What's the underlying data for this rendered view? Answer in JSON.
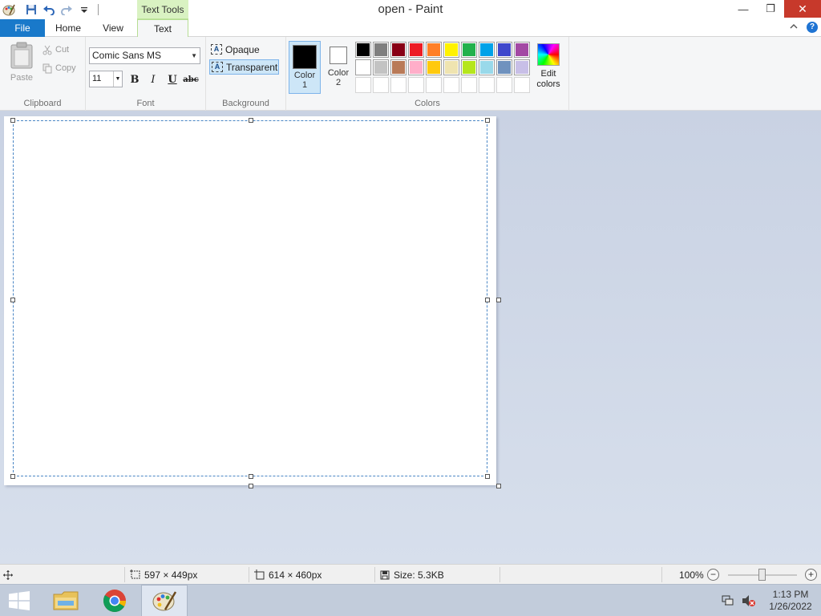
{
  "window": {
    "title": "open - Paint",
    "context_tab_group": "Text Tools",
    "minimize": "—",
    "restore": "❐",
    "close": "✕"
  },
  "tabs": {
    "file": "File",
    "home": "Home",
    "view": "View",
    "text": "Text"
  },
  "help": "?",
  "clipboard": {
    "label": "Clipboard",
    "paste": "Paste",
    "cut": "Cut",
    "copy": "Copy"
  },
  "font": {
    "label": "Font",
    "family": "Comic Sans MS",
    "size": "11",
    "bold": "B",
    "italic": "I",
    "underline": "U",
    "strike": "abc"
  },
  "background": {
    "label": "Background",
    "opaque": "Opaque",
    "transparent": "Transparent",
    "selected": "Transparent"
  },
  "colors": {
    "label": "Colors",
    "color1_line1": "Color",
    "color1_line2": "1",
    "color2_line1": "Color",
    "color2_line2": "2",
    "color1": "#000000",
    "color2": "#ffffff",
    "edit_line1": "Edit",
    "edit_line2": "colors",
    "palette_row1": [
      "#000000",
      "#7f7f7f",
      "#880015",
      "#ed1c24",
      "#ff7f27",
      "#fff200",
      "#22b14c",
      "#00a2e8",
      "#3f48cc",
      "#a349a4"
    ],
    "palette_row2": [
      "#ffffff",
      "#c3c3c3",
      "#b97a57",
      "#ffaec9",
      "#ffc90e",
      "#efe4b0",
      "#b5e61d",
      "#99d9ea",
      "#7092be",
      "#c8bfe7"
    ]
  },
  "status": {
    "selection_size": "597 × 449px",
    "canvas_size": "614 × 460px",
    "file_size": "Size: 5.3KB",
    "zoom": "100%",
    "zoom_out": "−",
    "zoom_in": "+"
  },
  "taskbar": {
    "time": "1:13 PM",
    "date": "1/26/2022"
  }
}
